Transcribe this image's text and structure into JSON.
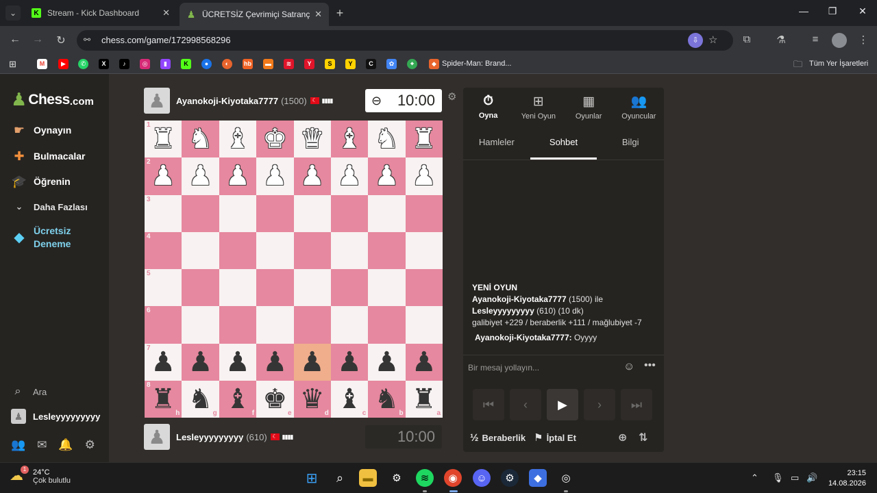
{
  "browser": {
    "tabs": [
      {
        "title": "Stream - Kick Dashboard",
        "favicon": "K"
      },
      {
        "title": "ÜCRETSİZ Çevrimiçi Satranç Oyna",
        "favicon": "♟"
      }
    ],
    "url": "chess.com/game/172998568296",
    "bookmarks": {
      "named_item": "Spider-Man: Brand...",
      "all_bookmarks": "Tüm Yer İşaretleri"
    }
  },
  "sidebar": {
    "logo_name": "Chess",
    "logo_domain": ".com",
    "items": [
      {
        "label": "Oynayın",
        "icon": "play-hand-icon"
      },
      {
        "label": "Bulmacalar",
        "icon": "puzzle-icon"
      },
      {
        "label": "Öğrenin",
        "icon": "learn-cap-icon"
      },
      {
        "label": "Daha Fazlası",
        "icon": "chevron-down-icon"
      }
    ],
    "premium": {
      "line1": "Ücretsiz",
      "line2": "Deneme"
    },
    "search_label": "Ara",
    "user": "Lesleyyyyyyyyy"
  },
  "game": {
    "top_player": {
      "name": "Ayanokoji-Kiyotaka7777",
      "rating": "(1500)",
      "clock": "10:00"
    },
    "bottom_player": {
      "name": "Lesleyyyyyyyyy",
      "rating": "(610)",
      "clock": "10:00"
    },
    "board": {
      "ranks": [
        "1",
        "2",
        "3",
        "4",
        "5",
        "6",
        "7",
        "8"
      ],
      "files": [
        "h",
        "g",
        "f",
        "e",
        "d",
        "c",
        "b",
        "a"
      ],
      "rows": [
        [
          "♜",
          "♞",
          "♝",
          "♚",
          "♛",
          "♝",
          "♞",
          "♜"
        ],
        [
          "♟",
          "♟",
          "♟",
          "♟",
          "♟",
          "♟",
          "♟",
          "♟"
        ],
        [
          "",
          "",
          "",
          "",
          "",
          "",
          "",
          ""
        ],
        [
          "",
          "",
          "",
          "",
          "",
          "",
          "",
          ""
        ],
        [
          "",
          "",
          "",
          "",
          "",
          "",
          "",
          ""
        ],
        [
          "",
          "",
          "",
          "",
          "",
          "",
          "",
          ""
        ],
        [
          "♟",
          "♟",
          "♟",
          "♟",
          "♟",
          "♟",
          "♟",
          "♟"
        ],
        [
          "♜",
          "♞",
          "♝",
          "♚",
          "♛",
          "♝",
          "♞",
          "♜"
        ]
      ]
    }
  },
  "panel": {
    "tabs": [
      {
        "label": "Oyna",
        "icon": "stopwatch-icon"
      },
      {
        "label": "Yeni Oyun",
        "icon": "plus-square-icon"
      },
      {
        "label": "Oyunlar",
        "icon": "board-icon"
      },
      {
        "label": "Oyuncular",
        "icon": "players-icon"
      }
    ],
    "subtabs": [
      "Hamleler",
      "Sohbet",
      "Bilgi"
    ],
    "chat": {
      "header": "YENİ OYUN",
      "line1_name": "Ayanokoji-Kiyotaka7777",
      "line1_rest": "(1500) ile",
      "line2_name": "Lesleyyyyyyyyy",
      "line2_rest": "(610) (10 dk)",
      "line3": "galibiyet +229 / beraberlik +111 / mağlubiyet -7",
      "msg_author": "Ayanokoji-Kiyotaka7777:",
      "msg_text": "Oyyyy"
    },
    "chat_placeholder": "Bir mesaj yollayın...",
    "draw_label": "Beraberlik",
    "abort_label": "İptal Et",
    "draw_symbol": "½"
  },
  "taskbar": {
    "temperature": "24°C",
    "weather_desc": "Çok bulutlu",
    "weather_badge": "1",
    "time": "23:15",
    "date": "14.08.2026"
  }
}
